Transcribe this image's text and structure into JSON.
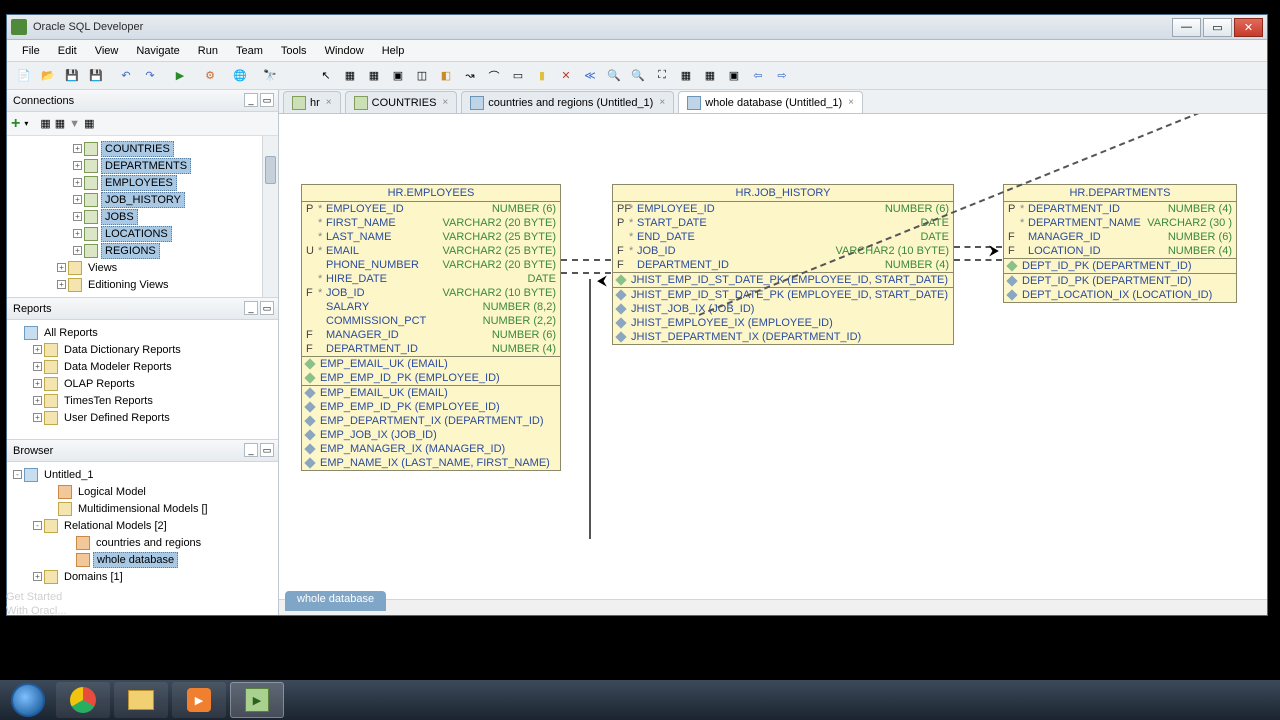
{
  "app": {
    "title": "Oracle SQL Developer"
  },
  "menu": [
    "File",
    "Edit",
    "View",
    "Navigate",
    "Run",
    "Team",
    "Tools",
    "Window",
    "Help"
  ],
  "panels": {
    "connections": "Connections",
    "reports": "Reports",
    "browser": "Browser"
  },
  "connections_tree": [
    {
      "label": "COUNTRIES",
      "sel": true,
      "indent": 64,
      "exp": "+",
      "icon": "tbl-ic"
    },
    {
      "label": "DEPARTMENTS",
      "sel": true,
      "indent": 64,
      "exp": "+",
      "icon": "tbl-ic"
    },
    {
      "label": "EMPLOYEES",
      "sel": true,
      "indent": 64,
      "exp": "+",
      "icon": "tbl-ic"
    },
    {
      "label": "JOB_HISTORY",
      "sel": true,
      "indent": 64,
      "exp": "+",
      "icon": "tbl-ic"
    },
    {
      "label": "JOBS",
      "sel": true,
      "indent": 64,
      "exp": "+",
      "icon": "tbl-ic"
    },
    {
      "label": "LOCATIONS",
      "sel": true,
      "indent": 64,
      "exp": "+",
      "icon": "tbl-ic"
    },
    {
      "label": "REGIONS",
      "sel": true,
      "indent": 64,
      "exp": "+",
      "icon": "tbl-ic",
      "dotted": true
    },
    {
      "label": "Views",
      "sel": false,
      "indent": 48,
      "exp": "+",
      "icon": "fld-ic"
    },
    {
      "label": "Editioning Views",
      "sel": false,
      "indent": 48,
      "exp": "+",
      "icon": "fld-ic"
    }
  ],
  "reports_tree": [
    {
      "label": "All Reports",
      "indent": 4,
      "icon": "blu-ic"
    },
    {
      "label": "Data Dictionary Reports",
      "indent": 24,
      "exp": "+",
      "icon": "fld-ic"
    },
    {
      "label": "Data Modeler Reports",
      "indent": 24,
      "exp": "+",
      "icon": "fld-ic"
    },
    {
      "label": "OLAP Reports",
      "indent": 24,
      "exp": "+",
      "icon": "fld-ic"
    },
    {
      "label": "TimesTen Reports",
      "indent": 24,
      "exp": "+",
      "icon": "fld-ic"
    },
    {
      "label": "User Defined Reports",
      "indent": 24,
      "exp": "+",
      "icon": "fld-ic"
    }
  ],
  "browser_tree": [
    {
      "label": "Untitled_1",
      "indent": 4,
      "exp": "-",
      "icon": "blu-ic"
    },
    {
      "label": "Logical Model",
      "indent": 38,
      "icon": "ora-ic"
    },
    {
      "label": "Multidimensional Models []",
      "indent": 38,
      "icon": "fld-ic"
    },
    {
      "label": "Relational Models [2]",
      "indent": 24,
      "exp": "-",
      "icon": "fld-ic"
    },
    {
      "label": "countries and regions",
      "indent": 56,
      "icon": "ora-ic"
    },
    {
      "label": "whole database",
      "indent": 56,
      "icon": "ora-ic",
      "sel": true
    },
    {
      "label": "Domains [1]",
      "indent": 24,
      "exp": "+",
      "icon": "fld-ic"
    }
  ],
  "doc_tabs": [
    {
      "label": "hr",
      "icon": "dticon"
    },
    {
      "label": "COUNTRIES",
      "icon": "dticon"
    },
    {
      "label": "countries and regions (Untitled_1)",
      "icon": "dticon merd"
    },
    {
      "label": "whole database (Untitled_1)",
      "icon": "dticon merd",
      "active": true
    }
  ],
  "entities": {
    "employees": {
      "title": "HR.EMPLOYEES",
      "cols": [
        {
          "pk": "P",
          "m": "*",
          "name": "EMPLOYEE_ID",
          "type": "NUMBER (6)"
        },
        {
          "pk": "",
          "m": "*",
          "name": "FIRST_NAME",
          "type": "VARCHAR2 (20 BYTE)"
        },
        {
          "pk": "",
          "m": "*",
          "name": "LAST_NAME",
          "type": "VARCHAR2 (25 BYTE)"
        },
        {
          "pk": "U",
          "m": "*",
          "name": "EMAIL",
          "type": "VARCHAR2 (25 BYTE)"
        },
        {
          "pk": "",
          "m": "",
          "name": "PHONE_NUMBER",
          "type": "VARCHAR2 (20 BYTE)"
        },
        {
          "pk": "",
          "m": "*",
          "name": "HIRE_DATE",
          "type": "DATE"
        },
        {
          "pk": "F",
          "m": "*",
          "name": "JOB_ID",
          "type": "VARCHAR2 (10 BYTE)"
        },
        {
          "pk": "",
          "m": "",
          "name": "SALARY",
          "type": "NUMBER (8,2)"
        },
        {
          "pk": "",
          "m": "",
          "name": "COMMISSION_PCT",
          "type": "NUMBER (2,2)"
        },
        {
          "pk": "F",
          "m": "",
          "name": "MANAGER_ID",
          "type": "NUMBER (6)"
        },
        {
          "pk": "F",
          "m": "",
          "name": "DEPARTMENT_ID",
          "type": "NUMBER (4)"
        }
      ],
      "idx1": [
        {
          "name": "EMP_EMAIL_UK (EMAIL)"
        },
        {
          "name": "EMP_EMP_ID_PK (EMPLOYEE_ID)"
        }
      ],
      "idx2": [
        {
          "name": "EMP_EMAIL_UK (EMAIL)"
        },
        {
          "name": "EMP_EMP_ID_PK (EMPLOYEE_ID)"
        },
        {
          "name": "EMP_DEPARTMENT_IX (DEPARTMENT_ID)"
        },
        {
          "name": "EMP_JOB_IX (JOB_ID)"
        },
        {
          "name": "EMP_MANAGER_IX (MANAGER_ID)"
        },
        {
          "name": "EMP_NAME_IX (LAST_NAME, FIRST_NAME)"
        }
      ]
    },
    "job_history": {
      "title": "HR.JOB_HISTORY",
      "cols": [
        {
          "pk": "PF",
          "m": "*",
          "name": "EMPLOYEE_ID",
          "type": "NUMBER (6)"
        },
        {
          "pk": "P",
          "m": "*",
          "name": "START_DATE",
          "type": "DATE"
        },
        {
          "pk": "",
          "m": "*",
          "name": "END_DATE",
          "type": "DATE"
        },
        {
          "pk": "F",
          "m": "*",
          "name": "JOB_ID",
          "type": "VARCHAR2 (10 BYTE)"
        },
        {
          "pk": "F",
          "m": "",
          "name": "DEPARTMENT_ID",
          "type": "NUMBER (4)"
        }
      ],
      "idx1": [
        {
          "name": "JHIST_EMP_ID_ST_DATE_PK (EMPLOYEE_ID, START_DATE)"
        }
      ],
      "idx2": [
        {
          "name": "JHIST_EMP_ID_ST_DATE_PK (EMPLOYEE_ID, START_DATE)"
        },
        {
          "name": "JHIST_JOB_IX (JOB_ID)"
        },
        {
          "name": "JHIST_EMPLOYEE_IX (EMPLOYEE_ID)"
        },
        {
          "name": "JHIST_DEPARTMENT_IX (DEPARTMENT_ID)"
        }
      ]
    },
    "departments": {
      "title": "HR.DEPARTMENTS",
      "cols": [
        {
          "pk": "P",
          "m": "*",
          "name": "DEPARTMENT_ID",
          "type": "NUMBER (4)"
        },
        {
          "pk": "",
          "m": "*",
          "name": "DEPARTMENT_NAME",
          "type": "VARCHAR2 (30 )"
        },
        {
          "pk": "F",
          "m": "",
          "name": "MANAGER_ID",
          "type": "NUMBER (6)"
        },
        {
          "pk": "F",
          "m": "",
          "name": "LOCATION_ID",
          "type": "NUMBER (4)"
        }
      ],
      "idx1": [
        {
          "name": "DEPT_ID_PK (DEPARTMENT_ID)"
        }
      ],
      "idx2": [
        {
          "name": "DEPT_ID_PK (DEPARTMENT_ID)"
        },
        {
          "name": "DEPT_LOCATION_IX (LOCATION_ID)"
        }
      ]
    }
  },
  "bottom_tab": "whole database",
  "status": {
    "l1": "Get Started",
    "l2": "With Oracl..."
  }
}
